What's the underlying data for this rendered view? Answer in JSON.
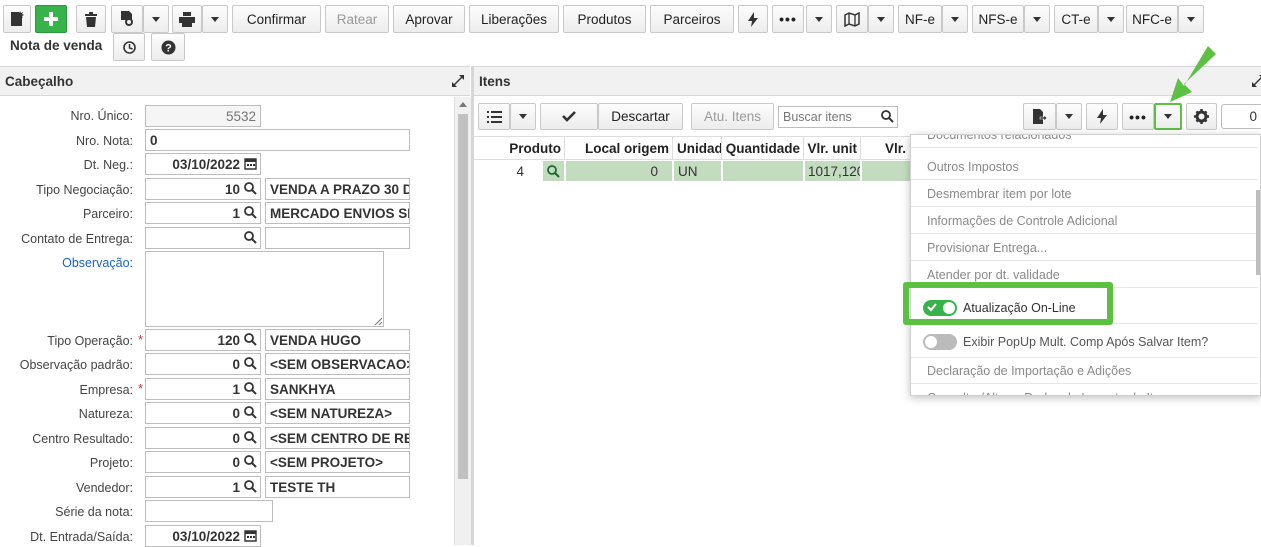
{
  "toolbar": {
    "confirmar": "Confirmar",
    "ratear": "Ratear",
    "aprovar": "Aprovar",
    "liberacoes": "Liberações",
    "produtos": "Produtos",
    "parceiros": "Parceiros",
    "nfe": "NF-e",
    "nfse": "NFS-e",
    "cte": "CT-e",
    "nfce": "NFC-e",
    "nota_de_venda": "Nota de venda"
  },
  "cabecalho": {
    "title": "Cabeçalho",
    "fields": {
      "nro_unico": {
        "label": "Nro. Único:",
        "value": "5532"
      },
      "nro_nota": {
        "label": "Nro. Nota:",
        "value": "0"
      },
      "dt_neg": {
        "label": "Dt. Neg.:",
        "value": "03/10/2022"
      },
      "tipo_negociacao": {
        "label": "Tipo Negociação:",
        "code": "10",
        "desc": "VENDA A PRAZO 30 D"
      },
      "parceiro": {
        "label": "Parceiro:",
        "code": "1",
        "desc": "MERCADO ENVIOS SE"
      },
      "contato": {
        "label": "Contato de Entrega:",
        "code": "",
        "desc": ""
      },
      "observacao": {
        "label": "Observação:",
        "value": ""
      },
      "tipo_operacao": {
        "label": "Tipo Operação:",
        "code": "120",
        "desc": "VENDA HUGO"
      },
      "obs_padrao": {
        "label": "Observação padrão:",
        "code": "0",
        "desc": "<SEM OBSERVACAO>"
      },
      "empresa": {
        "label": "Empresa:",
        "code": "1",
        "desc": "SANKHYA"
      },
      "natureza": {
        "label": "Natureza:",
        "code": "0",
        "desc": "<SEM NATUREZA>"
      },
      "centro_resultado": {
        "label": "Centro Resultado:",
        "code": "0",
        "desc": "<SEM CENTRO DE RE"
      },
      "projeto": {
        "label": "Projeto:",
        "code": "0",
        "desc": "<SEM PROJETO>"
      },
      "vendedor": {
        "label": "Vendedor:",
        "code": "1",
        "desc": "TESTE TH"
      },
      "serie": {
        "label": "Série da nota:",
        "value": ""
      },
      "dt_entrada": {
        "label": "Dt. Entrada/Saída:",
        "value": "03/10/2022"
      }
    },
    "required_mark": "*"
  },
  "itens": {
    "title": "Itens",
    "descartar": "Descartar",
    "atu_itens": "Atu. Itens",
    "search_placeholder": "Buscar itens",
    "counter": "0",
    "columns": [
      "Produto",
      "Local origem",
      "Unidad",
      "Quantidade",
      "Vlr. unit",
      "Vlr. t"
    ],
    "row": {
      "produto": "4",
      "local_origem": "0",
      "unidade": "UN",
      "quantidade": "",
      "vlr_unit": "1017,120"
    }
  },
  "menu": {
    "items": [
      "Documentos relacionados",
      "Outros Impostos",
      "Desmembrar item por lote",
      "Informações de Controle Adicional",
      "Provisionar Entrega...",
      "Atender por dt. validade",
      "Atualização On-Line",
      "Exibir PopUp Mult. Comp Após Salvar Item?",
      "Declaração de Importação e Adições",
      "Consultar/Alterar Dados do Imposto do Item"
    ],
    "toggle_online": true,
    "toggle_popup": false
  },
  "colors": {
    "green": "#37b34a",
    "highlight": "#5cc043",
    "row_bg": "#c3dcc0",
    "link": "#1a64c8"
  }
}
